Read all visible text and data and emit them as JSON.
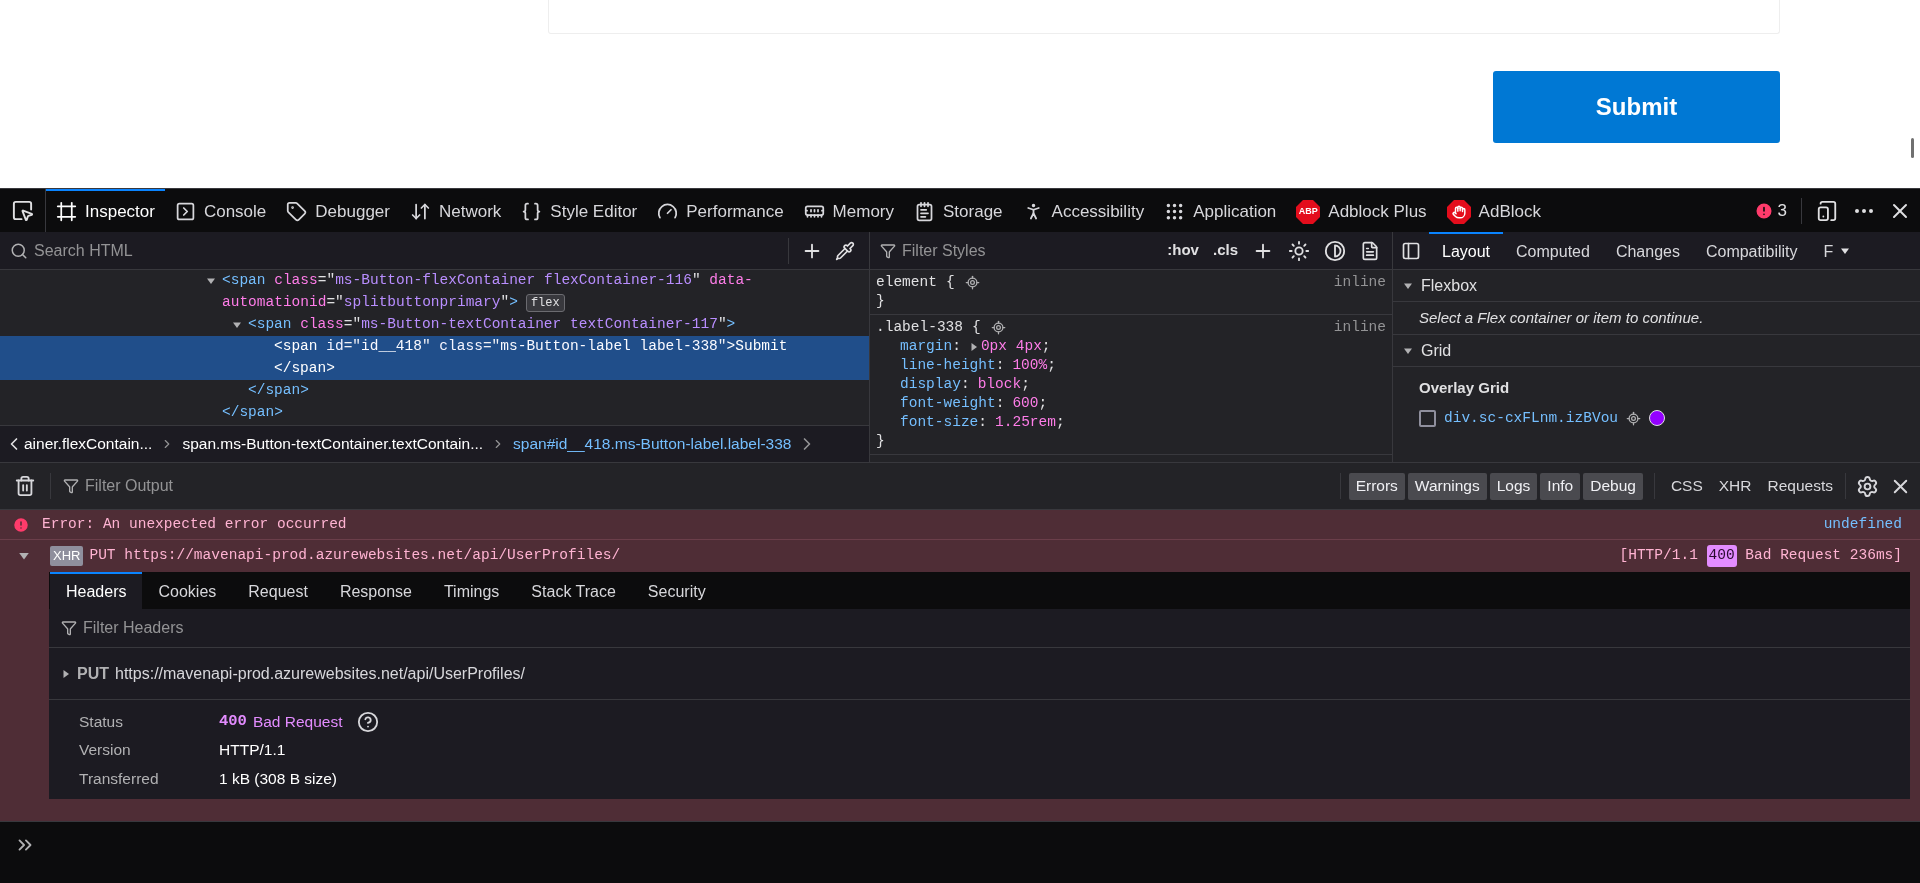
{
  "page": {
    "submit_button": "Submit"
  },
  "toolbar": {
    "tabs": [
      {
        "label": "Inspector",
        "selected": true
      },
      {
        "label": "Console",
        "selected": false
      },
      {
        "label": "Debugger",
        "selected": false
      },
      {
        "label": "Network",
        "selected": false
      },
      {
        "label": "Style Editor",
        "selected": false
      },
      {
        "label": "Performance",
        "selected": false
      },
      {
        "label": "Memory",
        "selected": false
      },
      {
        "label": "Storage",
        "selected": false
      },
      {
        "label": "Accessibility",
        "selected": false
      },
      {
        "label": "Application",
        "selected": false
      },
      {
        "label": "Adblock Plus",
        "logo_text": "ABP",
        "selected": false
      },
      {
        "label": "AdBlock",
        "selected": false
      }
    ],
    "error_count": "3"
  },
  "markup": {
    "search_placeholder": "Search HTML",
    "tree": [
      {
        "expanded": true,
        "selected": false,
        "lines": [
          [
            {
              "kind": "tag",
              "text": "<span"
            },
            {
              "kind": "attr",
              "text": " class"
            },
            {
              "kind": "punct",
              "text": "=\""
            },
            {
              "kind": "value",
              "text": "ms-Button-flexContainer flexContainer-116"
            },
            {
              "kind": "punct",
              "text": "\""
            },
            {
              "kind": "attr",
              "text": " data-"
            }
          ],
          [
            {
              "kind": "attr",
              "text": "automationid"
            },
            {
              "kind": "punct",
              "text": "=\""
            },
            {
              "kind": "value",
              "text": "splitbuttonprimary"
            },
            {
              "kind": "punct",
              "text": "\""
            },
            {
              "kind": "tag",
              "text": ">"
            },
            {
              "kind": "badge",
              "text": "flex"
            }
          ]
        ],
        "children": [
          {
            "expanded": true,
            "selected": false,
            "lines": [
              [
                {
                  "kind": "tag",
                  "text": "<span"
                },
                {
                  "kind": "attr",
                  "text": " class"
                },
                {
                  "kind": "punct",
                  "text": "=\""
                },
                {
                  "kind": "value",
                  "text": "ms-Button-textContainer textContainer-117"
                },
                {
                  "kind": "punct",
                  "text": "\""
                },
                {
                  "kind": "tag",
                  "text": ">"
                }
              ]
            ],
            "children": [
              {
                "selected": true,
                "lines": [
                  [
                    {
                      "kind": "tag",
                      "text": "<span"
                    },
                    {
                      "kind": "attr",
                      "text": " id"
                    },
                    {
                      "kind": "punct",
                      "text": "=\""
                    },
                    {
                      "kind": "value",
                      "text": "id__418"
                    },
                    {
                      "kind": "punct",
                      "text": "\""
                    },
                    {
                      "kind": "attr",
                      "text": " class"
                    },
                    {
                      "kind": "punct",
                      "text": "=\""
                    },
                    {
                      "kind": "value",
                      "text": "ms-Button-label label-338"
                    },
                    {
                      "kind": "punct",
                      "text": "\""
                    },
                    {
                      "kind": "tag",
                      "text": ">"
                    },
                    {
                      "kind": "text",
                      "text": "Submit"
                    }
                  ],
                  [
                    {
                      "kind": "tag",
                      "text": "</span>"
                    }
                  ]
                ]
              }
            ],
            "closing": "</span>"
          }
        ],
        "closing": "</span>"
      }
    ],
    "breadcrumbs": [
      {
        "label": "ainer.flexContain...",
        "selected": false
      },
      {
        "label": "span.ms-Button-textContainer.textContain...",
        "selected": false
      },
      {
        "label": "span#id__418.ms-Button-label.label-338",
        "selected": true
      }
    ]
  },
  "rules": {
    "filter_placeholder": "Filter Styles",
    "hov": ":hov",
    "cls": ".cls",
    "list": [
      {
        "selector": "element",
        "brace": "{",
        "source": "inline",
        "closing": "}"
      },
      {
        "selector": ".label-338",
        "brace": "{",
        "source": "inline",
        "closing": "}",
        "declarations": [
          {
            "expandable": true,
            "tokens": [
              {
                "kind": "prop",
                "text": "margin"
              },
              {
                "kind": "punct",
                "text": ":"
              },
              {
                "kind": "value",
                "text": "0px 4px"
              },
              {
                "kind": "punct",
                "text": ";"
              }
            ]
          },
          {
            "expandable": false,
            "tokens": [
              {
                "kind": "prop",
                "text": "line-height"
              },
              {
                "kind": "punct",
                "text": ":"
              },
              {
                "kind": "value",
                "text": "100%"
              },
              {
                "kind": "punct",
                "text": ";"
              }
            ]
          },
          {
            "expandable": false,
            "tokens": [
              {
                "kind": "prop",
                "text": "display"
              },
              {
                "kind": "punct",
                "text": ":"
              },
              {
                "kind": "value",
                "text": "block"
              },
              {
                "kind": "punct",
                "text": ";"
              }
            ]
          },
          {
            "expandable": false,
            "tokens": [
              {
                "kind": "prop",
                "text": "font-weight"
              },
              {
                "kind": "punct",
                "text": ":"
              },
              {
                "kind": "value",
                "text": "600"
              },
              {
                "kind": "punct",
                "text": ";"
              }
            ]
          },
          {
            "expandable": false,
            "tokens": [
              {
                "kind": "prop",
                "text": "font-size"
              },
              {
                "kind": "punct",
                "text": ":"
              },
              {
                "kind": "value",
                "text": "1.25rem"
              },
              {
                "kind": "punct",
                "text": ";"
              }
            ]
          }
        ]
      }
    ]
  },
  "sidebar": {
    "tabs": [
      {
        "label": "Layout",
        "selected": true
      },
      {
        "label": "Computed",
        "selected": false
      },
      {
        "label": "Changes",
        "selected": false
      },
      {
        "label": "Compatibility",
        "selected": false
      },
      {
        "label": "F",
        "selected": false
      }
    ],
    "flexbox": {
      "title": "Flexbox",
      "expanded": true,
      "message": "Select a Flex container or item to continue."
    },
    "grid": {
      "title": "Grid",
      "expanded": true,
      "overlay_title": "Overlay Grid",
      "items": [
        {
          "label": "div.sc-cxFLnm.izBVou",
          "checked": false,
          "color": "#9400ff"
        }
      ]
    }
  },
  "console": {
    "filter_placeholder": "Filter Output",
    "levels": [
      {
        "label": "Errors",
        "selected": true
      },
      {
        "label": "Warnings",
        "selected": true
      },
      {
        "label": "Logs",
        "selected": true
      },
      {
        "label": "Info",
        "selected": true
      },
      {
        "label": "Debug",
        "selected": true
      }
    ],
    "types": [
      {
        "label": "CSS",
        "selected": false
      },
      {
        "label": "XHR",
        "selected": false
      },
      {
        "label": "Requests",
        "selected": false
      }
    ],
    "error": {
      "message": "Error: An unexpected error occurred",
      "source": "undefined"
    },
    "xhr": {
      "badge": "XHR",
      "expanded": true,
      "method": "PUT",
      "url": "https://mavenapi-prod.azurewebsites.net/api/UserProfiles/",
      "protocol": "[HTTP/1.1",
      "code": "400",
      "summary": "Bad Request 236ms]",
      "tabs": [
        {
          "label": "Headers",
          "selected": true
        },
        {
          "label": "Cookies",
          "selected": false
        },
        {
          "label": "Request",
          "selected": false
        },
        {
          "label": "Response",
          "selected": false
        },
        {
          "label": "Timings",
          "selected": false
        },
        {
          "label": "Stack Trace",
          "selected": false
        },
        {
          "label": "Security",
          "selected": false
        }
      ],
      "filter_placeholder": "Filter Headers",
      "request": {
        "method": "PUT",
        "url": "https://mavenapi-prod.azurewebsites.net/api/UserProfiles/",
        "expanded": false
      },
      "status": {
        "label": "Status",
        "code": "400",
        "text": "Bad Request"
      },
      "rows": [
        {
          "label": "Version",
          "value": "HTTP/1.1"
        },
        {
          "label": "Transferred",
          "value": "1 kB (308 B size)"
        }
      ]
    }
  }
}
